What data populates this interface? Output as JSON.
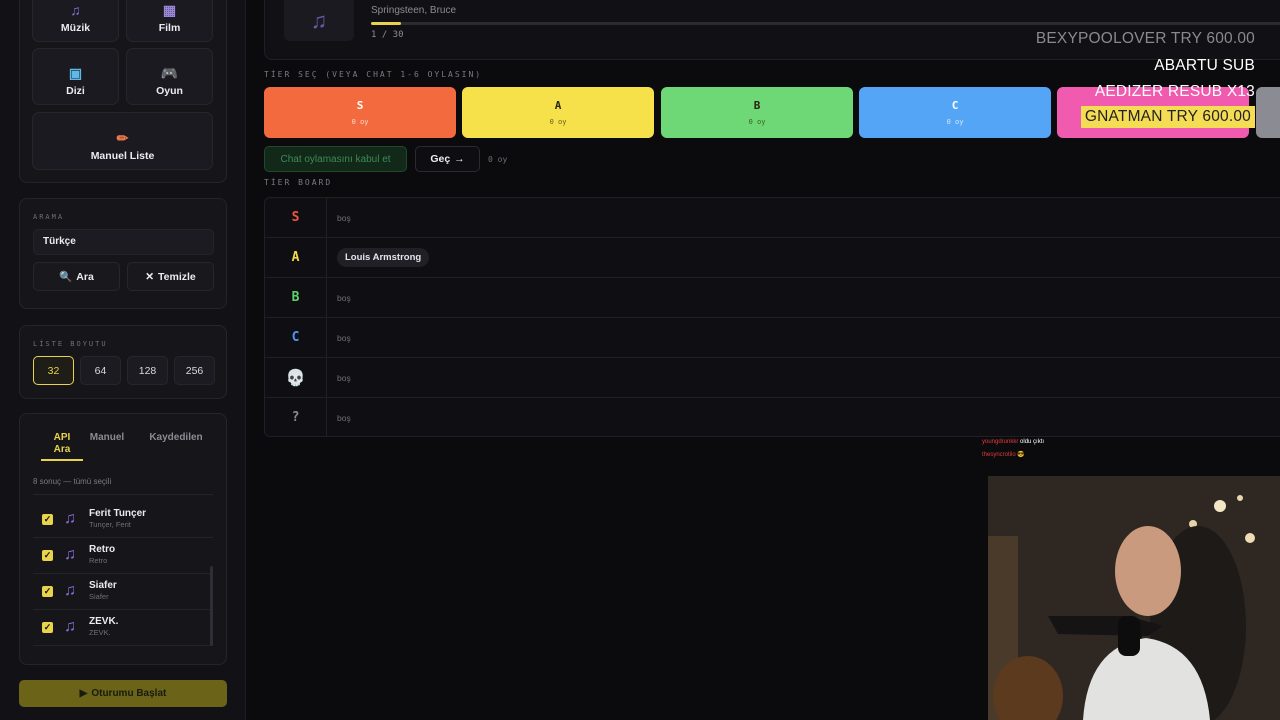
{
  "sidebar": {
    "categories": [
      {
        "label": "Müzik",
        "icon": "music-note-icon"
      },
      {
        "label": "Film",
        "icon": "film-icon"
      },
      {
        "label": "Dizi",
        "icon": "tv-icon"
      },
      {
        "label": "Oyun",
        "icon": "gamepad-icon"
      },
      {
        "label": "Manuel Liste",
        "icon": "pencil-icon"
      }
    ],
    "search": {
      "section_label": "ARAMA",
      "value": "Türkçe",
      "search_button": "Ara",
      "clear_button": "Temizle"
    },
    "size": {
      "section_label": "LİSTE BOYUTU",
      "options": [
        "32",
        "64",
        "128",
        "256"
      ],
      "selected": "32"
    },
    "tabs": {
      "api_line1": "API",
      "api_line2": "Ara",
      "manual": "Manuel",
      "saved": "Kaydedilen"
    },
    "results": {
      "summary": "8 sonuç — tümü seçili",
      "items": [
        {
          "title": "Ferit Tunçer",
          "subtitle": "Tunçer, Ferit"
        },
        {
          "title": "Retro",
          "subtitle": "Retro"
        },
        {
          "title": "Siafer",
          "subtitle": "Siafer"
        },
        {
          "title": "ZEVK.",
          "subtitle": "ZEVK."
        }
      ]
    },
    "start_button": "Oturumu Başlat"
  },
  "now_playing": {
    "subtitle": "Springsteen, Bruce",
    "counter": "1 / 30",
    "progress": 0.033
  },
  "tier_select": {
    "label": "TİER SEÇ (VEYA CHAT 1-6 OYLASIN)",
    "tiers": [
      {
        "letter": "S",
        "votes": "0 oy",
        "color": "#f26a3d"
      },
      {
        "letter": "A",
        "votes": "0 oy",
        "color": "#f6e14b"
      },
      {
        "letter": "B",
        "votes": "0 oy",
        "color": "#6fd876"
      },
      {
        "letter": "C",
        "votes": "0 oy",
        "color": "#55a5f7"
      },
      {
        "letter": "",
        "votes": "",
        "color": "#f05bb0"
      }
    ],
    "chat_accept": "Chat oylamasını kabul et",
    "skip_button": "Geç",
    "skip_votes": "0 oy"
  },
  "board": {
    "label": "TİER BOARD",
    "rows": [
      {
        "label": "S",
        "color": "#f2553d",
        "empty": "boş",
        "item": ""
      },
      {
        "label": "A",
        "color": "#f2d94a",
        "empty": "",
        "item": "Louis Armstrong"
      },
      {
        "label": "B",
        "color": "#5fd36a",
        "empty": "boş",
        "item": ""
      },
      {
        "label": "C",
        "color": "#4f95f0",
        "empty": "boş",
        "item": ""
      },
      {
        "label": "💀",
        "color": "#e8e8ec",
        "empty": "boş",
        "item": ""
      },
      {
        "label": "?",
        "color": "#8b8b94",
        "empty": "boş",
        "item": ""
      }
    ]
  },
  "overlay": {
    "alerts": [
      {
        "text": "BEXYPOOLOVER  TRY 600.00",
        "color": "#8a8a8a"
      },
      {
        "text": "ABARTU  SUB",
        "color": "#ffffff"
      },
      {
        "text": "AEDIZER  RESUB X13",
        "color": "#ffffff"
      },
      {
        "text": "GNATMAN  TRY 600.00",
        "color": "#222222",
        "bg": "#f5dc55"
      }
    ],
    "chat": [
      {
        "user": "youngdrunkkr",
        "message": "oldu çıktı",
        "user_color": "#e33b3b"
      },
      {
        "user": "thesyncrotilo",
        "message": "😎",
        "user_color": "#e33b3b"
      }
    ]
  }
}
